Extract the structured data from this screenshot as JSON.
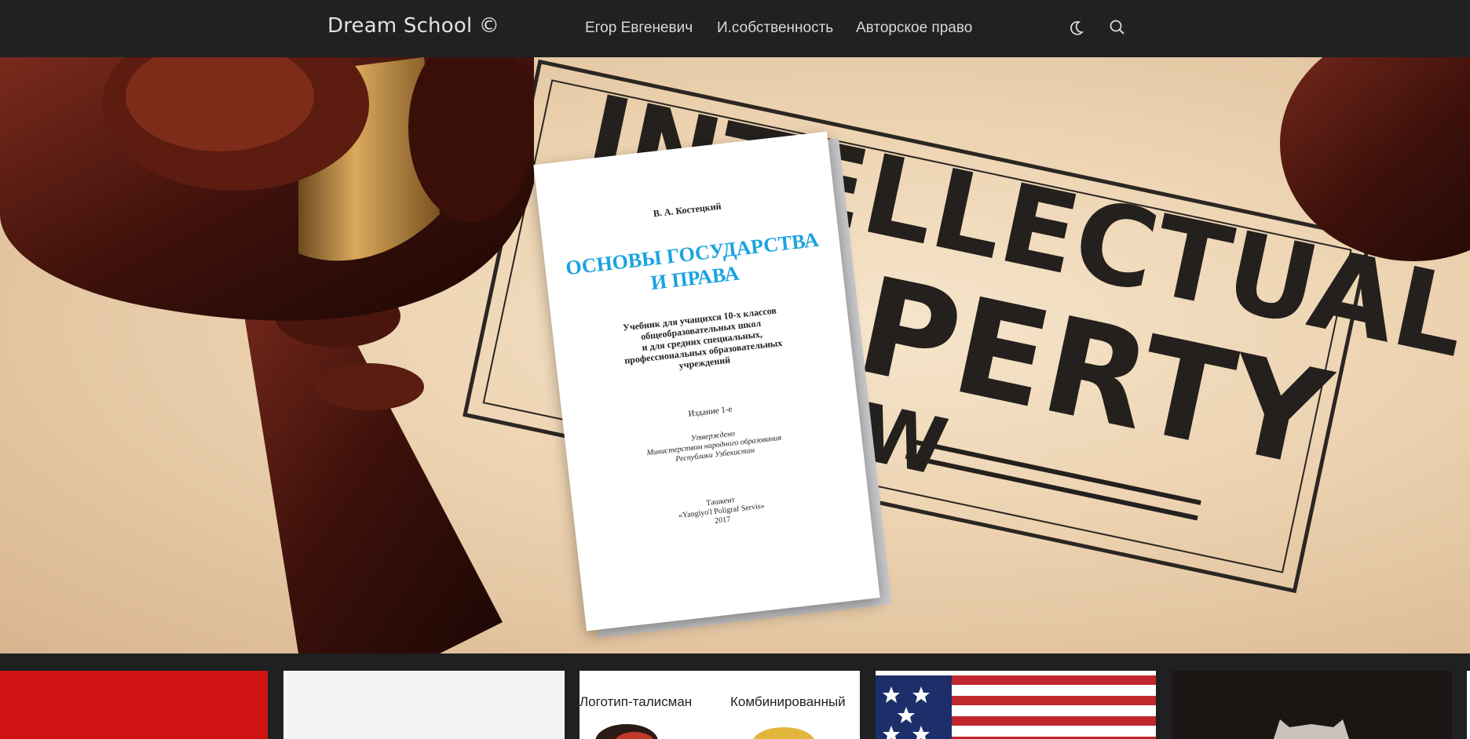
{
  "header": {
    "brand": "Dream School ©",
    "nav": [
      "Егор Евгеневич",
      "И.собственность",
      "Авторское право"
    ],
    "icons": [
      "moon-icon",
      "search-icon"
    ]
  },
  "hero": {
    "background_text": [
      "INTELLECTUAL",
      "PROPERTY",
      "LAW"
    ],
    "book": {
      "author": "В. А. Костецкий",
      "title": [
        "ОСНОВЫ ГОСУДАРСТВА",
        "И ПРАВА"
      ],
      "subtitle": [
        "Учебник для учащихся 10-х классов",
        "общеобразовательных школ",
        "и для средних специальных,",
        "профессиональных образовательных",
        "учреждений"
      ],
      "edition": "Издание 1-е",
      "approved": [
        "Утверждено",
        "Министерством народного образования",
        "Республики Узбекистан"
      ],
      "place": [
        "Ташкент",
        "«Yangiyo'l Poligraf Servis»",
        "2017"
      ]
    }
  },
  "cards": {
    "card3": {
      "label_left": "Логотип-талисман",
      "label_right": "Комбинированный"
    }
  },
  "colors": {
    "header_bg": "#202122",
    "title_blue": "#1aa3df",
    "card_red": "#cf1313"
  }
}
